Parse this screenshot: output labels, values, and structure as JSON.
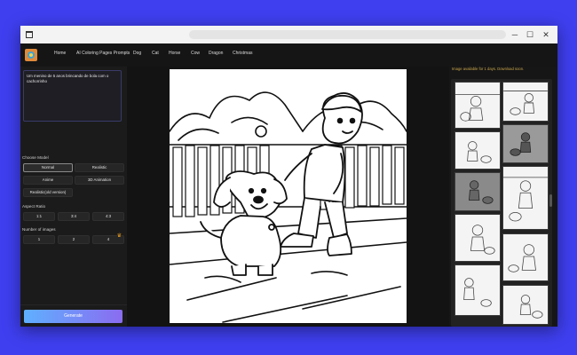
{
  "window": {
    "minimize_glyph": "─",
    "maximize_glyph": "☐",
    "close_glyph": "✕"
  },
  "nav": {
    "items": [
      "Home",
      "AI Coloring Pages Prompts",
      "Dog",
      "Cat",
      "Horse",
      "Cow",
      "Dragon",
      "Christmas"
    ]
  },
  "left_panel": {
    "prompt_text": "Um menino de 5 anos brincando de bola com o cachorrinho",
    "choose_model_label": "Choose Model",
    "models": [
      "Normal",
      "Realistic",
      "Anime",
      "3D Animation",
      "Realistic(old version)"
    ],
    "selected_model": "Normal",
    "aspect_ratio_label": "Aspect Ratio",
    "aspect_ratios": [
      "1:1",
      "3:4",
      "4:3"
    ],
    "number_of_images_label": "Number of images",
    "image_counts": [
      "1",
      "2",
      "4"
    ],
    "generate_label": "Generate"
  },
  "right_panel": {
    "notice": "Image available for 1 days. Download soon."
  },
  "colors": {
    "background": "#3f3ff0",
    "app_bg": "#131313",
    "notice": "#c9a64a",
    "generate_gradient_start": "#5fb0ff",
    "generate_gradient_end": "#8a6cf0",
    "premium": "#f0a020"
  }
}
